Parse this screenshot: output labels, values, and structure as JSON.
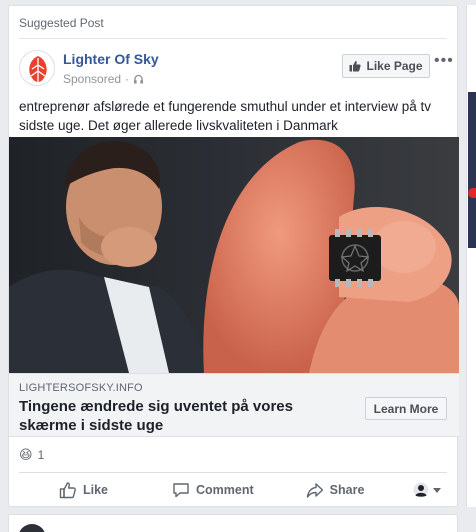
{
  "post": {
    "header_label": "Suggested Post",
    "page_name": "Lighter Of Sky",
    "sponsored": "Sponsored",
    "like_page_label": "Like Page",
    "more_label": "•••",
    "body_text": "entreprenør afslørede et fungerende smuthul under et interview på tv sidste uge. Det øger allerede livskvaliteten i Danmark"
  },
  "link_preview": {
    "domain": "LIGHTERSOFSKY.INFO",
    "title": "Tingene ændrede sig uventet på vores skærme i sidste uge",
    "cta_label": "Learn More"
  },
  "reactions": {
    "count": "1",
    "emoji": "😆"
  },
  "actions": {
    "like": "Like",
    "comment": "Comment",
    "share": "Share"
  },
  "colors": {
    "link_blue": "#365899",
    "logo_red": "#e8422f",
    "background": "#e9ebee"
  }
}
